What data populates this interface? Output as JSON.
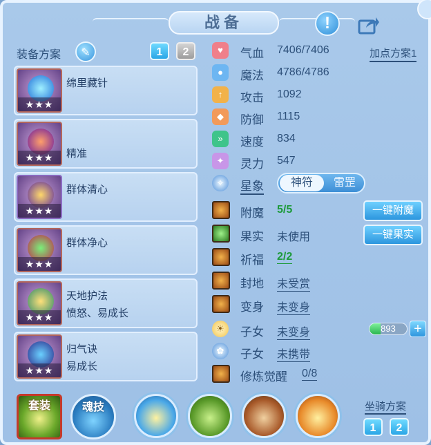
{
  "window": {
    "title": "战备"
  },
  "plan": {
    "label": "装备方案",
    "tabs": [
      "1",
      "2"
    ],
    "active_tab": "1"
  },
  "equipment": [
    {
      "name": "绵里藏针",
      "attr": "",
      "stars": "★★★"
    },
    {
      "name": "",
      "attr": "精准",
      "stars": "★★★"
    },
    {
      "name": "群体清心",
      "attr": "",
      "stars": "★★★"
    },
    {
      "name": "群体净心",
      "attr": "",
      "stars": "★★★"
    },
    {
      "name": "天地护法",
      "attr": "愤怒、易成长",
      "stars": "★★★"
    },
    {
      "name": "归气诀",
      "attr": "易成长",
      "stars": "★★★"
    }
  ],
  "stats": [
    {
      "label": "气血",
      "value": "7406/7406",
      "icon": "heart-icon",
      "color": "#f07f8a"
    },
    {
      "label": "魔法",
      "value": "4786/4786",
      "icon": "mana-icon",
      "color": "#6db6f2"
    },
    {
      "label": "攻击",
      "value": "1092",
      "icon": "sword-icon",
      "color": "#f2b24a"
    },
    {
      "label": "防御",
      "value": "1115",
      "icon": "shield-icon",
      "color": "#f29a5a"
    },
    {
      "label": "速度",
      "value": "834",
      "icon": "speed-icon",
      "color": "#3ec48a"
    },
    {
      "label": "灵力",
      "value": "547",
      "icon": "spirit-icon",
      "color": "#c896e8"
    }
  ],
  "point_plan": "加点方案1",
  "xingxiang": {
    "label": "星象",
    "options": [
      "神符",
      "雷罡"
    ],
    "active": "神符"
  },
  "features": [
    {
      "label": "附魔",
      "value": "5/5",
      "style": "green"
    },
    {
      "label": "果实",
      "value": "未使用",
      "style": ""
    },
    {
      "label": "祈福",
      "value": "2/2",
      "style": "green"
    },
    {
      "label": "封地",
      "value": "未受赏",
      "style": "link"
    },
    {
      "label": "变身",
      "value": "未变身",
      "style": "link"
    },
    {
      "label": "子女",
      "value": "未变身",
      "style": "link"
    },
    {
      "label": "子女",
      "value": "未携带",
      "style": "link"
    },
    {
      "label": "修炼觉醒",
      "value": "0/8",
      "style": "link"
    }
  ],
  "actions": {
    "enchant": "一键附魔",
    "fruit": "一键果实"
  },
  "child_bar": {
    "value": "893",
    "fill_fraction": 0.3
  },
  "bottom": {
    "set_label": "套装",
    "soul_label": "魂技",
    "mount_label": "坐骑方案",
    "mount_tabs": [
      "1",
      "2"
    ]
  },
  "colors": {
    "accent": "#2c96de",
    "panel": "#a9c9ea",
    "text": "#2c4f79",
    "green": "#1d9a3a"
  }
}
